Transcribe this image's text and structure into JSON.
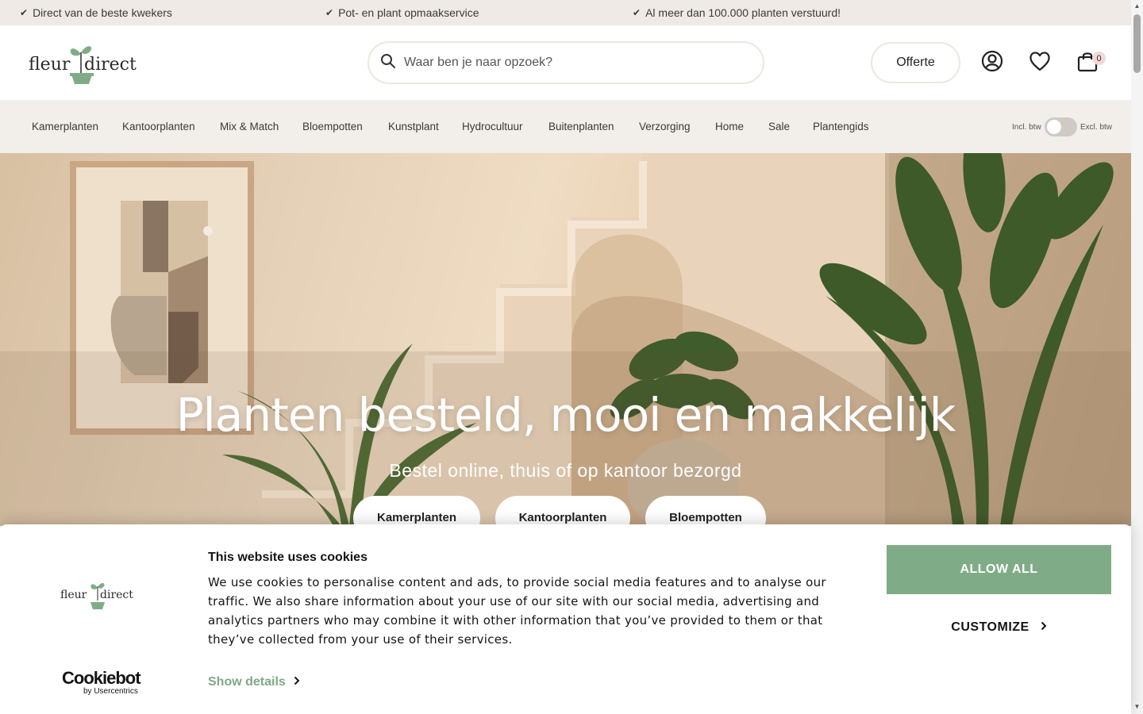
{
  "usp_bar": {
    "items": [
      {
        "icon": "check-icon",
        "label": "Direct van de beste kwekers"
      },
      {
        "icon": "check-icon",
        "label": "Pot- en plant opmaakservice"
      },
      {
        "icon": "check-icon",
        "label": "Al meer dan 100.000 planten verstuurd!"
      }
    ]
  },
  "header": {
    "logo_text": "fleur direct",
    "search": {
      "placeholder": "Waar ben je naar opzoek?",
      "icon": "search-icon"
    },
    "offerte_label": "Offerte",
    "account_icon": "user-icon",
    "wishlist_icon": "heart-icon",
    "cart_icon": "shopping-bag-icon",
    "cart_count": "0"
  },
  "nav": {
    "items": [
      {
        "label": "Kamerplanten"
      },
      {
        "label": "Kantoorplanten"
      },
      {
        "label": "Mix & Match"
      },
      {
        "label": "Bloempotten"
      },
      {
        "label": "Kunstplant"
      },
      {
        "label": "Hydrocultuur"
      },
      {
        "label": "Buitenplanten"
      },
      {
        "label": "Verzorging"
      },
      {
        "label": "Home"
      },
      {
        "label": "Sale"
      },
      {
        "label": "Plantengids"
      }
    ],
    "vat_toggle": {
      "incl_label": "Incl. btw",
      "excl_label": "Excl. btw",
      "state": "incl"
    }
  },
  "hero": {
    "title": "Planten besteld, mooi en makkelijk",
    "subtitle": "Bestel online, thuis of op kantoor bezorgd",
    "buttons": [
      {
        "label": "Kamerplanten"
      },
      {
        "label": "Kantoorplanten"
      },
      {
        "label": "Bloempotten"
      }
    ]
  },
  "cookie_banner": {
    "logo_text": "fleur direct",
    "title": "This website uses cookies",
    "body": "We use cookies to personalise content and ads, to provide social media features and to analyse our traffic. We also share information about your use of our site with our social media, advertising and analytics partners who may combine it with other information that you’ve provided to them or that they’ve collected from your use of their services.",
    "show_details_label": "Show details",
    "allow_all_label": "ALLOW ALL",
    "customize_label": "CUSTOMIZE",
    "provider_name": "Cookiebot",
    "provider_sub": "by Usercentrics"
  },
  "colors": {
    "brand_green": "#7fac86",
    "top_bar_bg": "#efeae5",
    "nav_bg": "#f2eeea",
    "text_dark": "#141414"
  }
}
